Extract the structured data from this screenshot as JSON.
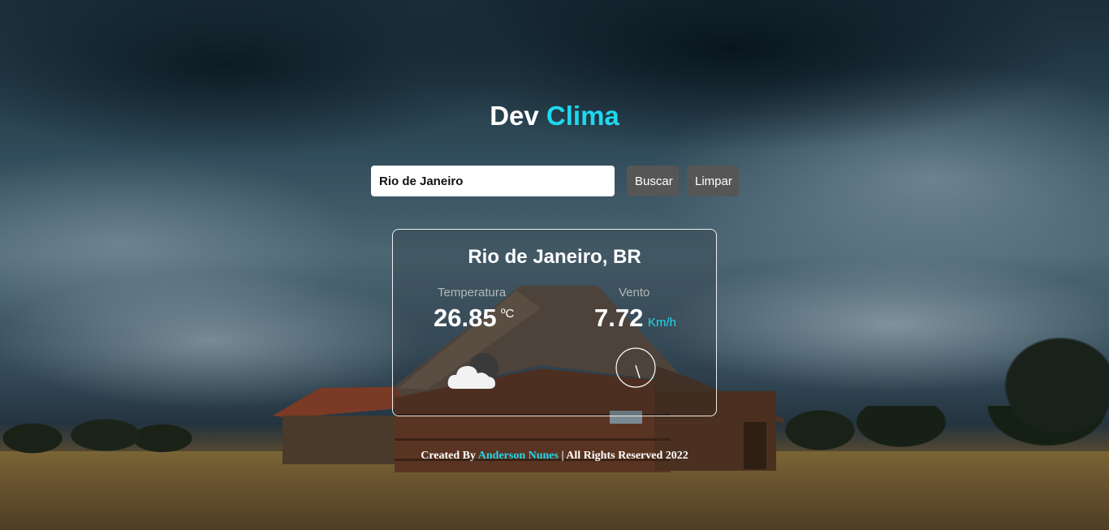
{
  "header": {
    "title_part1": "Dev",
    "title_part2": "Clima"
  },
  "search": {
    "value": "Rio de Janeiro",
    "placeholder": "",
    "search_label": "Buscar",
    "clear_label": "Limpar"
  },
  "weather": {
    "city": "Rio de Janeiro, BR",
    "temperature_label": "Temperatura",
    "temperature_value": "26.85",
    "temperature_unit": "ºC",
    "wind_label": "Vento",
    "wind_value": "7.72",
    "wind_unit": "Km/h",
    "condition_icon": "partly-cloudy-night-icon",
    "wind_direction_icon": "wind-compass-icon"
  },
  "footer": {
    "prefix": "Created By",
    "author": "Anderson Nunes",
    "suffix": "| All Rights Reserved 2022"
  },
  "colors": {
    "accent": "#1ed8ef",
    "button_bg": "#565656"
  }
}
